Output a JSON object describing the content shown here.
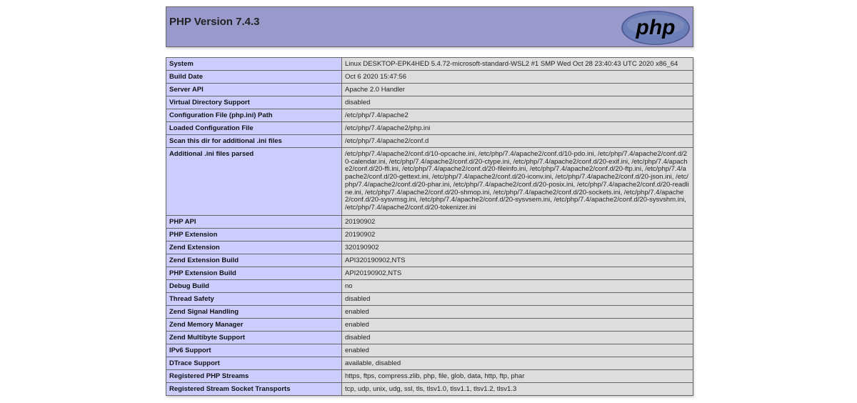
{
  "header": {
    "title": "PHP Version 7.4.3",
    "logo_text": "php",
    "logo_colors": {
      "oval": "#6c7eb7",
      "text": "#000000"
    }
  },
  "rows": [
    {
      "label": "System",
      "value": "Linux DESKTOP-EPK4HED 5.4.72-microsoft-standard-WSL2 #1 SMP Wed Oct 28 23:40:43 UTC 2020 x86_64"
    },
    {
      "label": "Build Date",
      "value": "Oct 6 2020 15:47:56"
    },
    {
      "label": "Server API",
      "value": "Apache 2.0 Handler"
    },
    {
      "label": "Virtual Directory Support",
      "value": "disabled"
    },
    {
      "label": "Configuration File (php.ini) Path",
      "value": "/etc/php/7.4/apache2"
    },
    {
      "label": "Loaded Configuration File",
      "value": "/etc/php/7.4/apache2/php.ini"
    },
    {
      "label": "Scan this dir for additional .ini files",
      "value": "/etc/php/7.4/apache2/conf.d"
    },
    {
      "label": "Additional .ini files parsed",
      "value": "/etc/php/7.4/apache2/conf.d/10-opcache.ini, /etc/php/7.4/apache2/conf.d/10-pdo.ini, /etc/php/7.4/apache2/conf.d/20-calendar.ini, /etc/php/7.4/apache2/conf.d/20-ctype.ini, /etc/php/7.4/apache2/conf.d/20-exif.ini, /etc/php/7.4/apache2/conf.d/20-ffi.ini, /etc/php/7.4/apache2/conf.d/20-fileinfo.ini, /etc/php/7.4/apache2/conf.d/20-ftp.ini, /etc/php/7.4/apache2/conf.d/20-gettext.ini, /etc/php/7.4/apache2/conf.d/20-iconv.ini, /etc/php/7.4/apache2/conf.d/20-json.ini, /etc/php/7.4/apache2/conf.d/20-phar.ini, /etc/php/7.4/apache2/conf.d/20-posix.ini, /etc/php/7.4/apache2/conf.d/20-readline.ini, /etc/php/7.4/apache2/conf.d/20-shmop.ini, /etc/php/7.4/apache2/conf.d/20-sockets.ini, /etc/php/7.4/apache2/conf.d/20-sysvmsg.ini, /etc/php/7.4/apache2/conf.d/20-sysvsem.ini, /etc/php/7.4/apache2/conf.d/20-sysvshm.ini, /etc/php/7.4/apache2/conf.d/20-tokenizer.ini",
      "multi": true
    },
    {
      "label": "PHP API",
      "value": "20190902"
    },
    {
      "label": "PHP Extension",
      "value": "20190902"
    },
    {
      "label": "Zend Extension",
      "value": "320190902"
    },
    {
      "label": "Zend Extension Build",
      "value": "API320190902,NTS"
    },
    {
      "label": "PHP Extension Build",
      "value": "API20190902,NTS"
    },
    {
      "label": "Debug Build",
      "value": "no"
    },
    {
      "label": "Thread Safety",
      "value": "disabled"
    },
    {
      "label": "Zend Signal Handling",
      "value": "enabled"
    },
    {
      "label": "Zend Memory Manager",
      "value": "enabled"
    },
    {
      "label": "Zend Multibyte Support",
      "value": "disabled"
    },
    {
      "label": "IPv6 Support",
      "value": "enabled"
    },
    {
      "label": "DTrace Support",
      "value": "available, disabled"
    },
    {
      "label": "Registered PHP Streams",
      "value": "https, ftps, compress.zlib, php, file, glob, data, http, ftp, phar"
    },
    {
      "label": "Registered Stream Socket Transports",
      "value": "tcp, udp, unix, udg, ssl, tls, tlsv1.0, tlsv1.1, tlsv1.2, tlsv1.3"
    }
  ]
}
